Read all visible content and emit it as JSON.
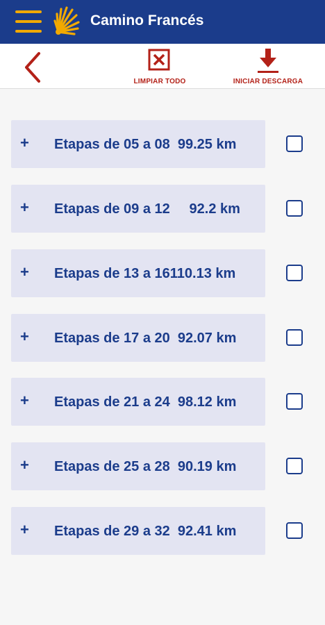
{
  "app_bar": {
    "title": "Camino Francés"
  },
  "toolbar": {
    "clear_label": "LIMPIAR TODO",
    "download_label": "INICIAR DESCARGA"
  },
  "stages": [
    {
      "label": "Etapas de 05 a 08  99.25 km",
      "checked": false
    },
    {
      "label": "Etapas de 09 a 12     92.2 km",
      "checked": false
    },
    {
      "label": "Etapas de 13 a 16110.13 km",
      "checked": false
    },
    {
      "label": "Etapas de 17 a 20  92.07 km",
      "checked": false
    },
    {
      "label": "Etapas de 21 a 24  98.12 km",
      "checked": false
    },
    {
      "label": "Etapas de 25 a 28  90.19 km",
      "checked": false
    },
    {
      "label": "Etapas de 29 a 32  92.41 km",
      "checked": false
    }
  ],
  "expand_symbol": "+",
  "colors": {
    "primary": "#1b3c8b",
    "accent": "#f2a900",
    "danger": "#b32118",
    "row_bg": "#e3e4f2"
  }
}
